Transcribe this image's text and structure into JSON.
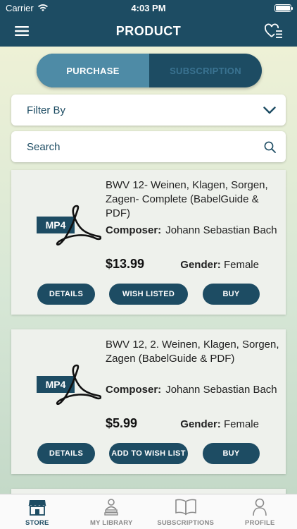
{
  "status_bar": {
    "carrier": "Carrier",
    "time": "4:03 PM"
  },
  "navbar": {
    "title": "PRODUCT",
    "menu_icon": "hamburger-icon",
    "wishlist_icon": "heart-list-icon"
  },
  "segment": {
    "purchase": "PURCHASE",
    "subscription": "SUBSCRIPTION",
    "active": "purchase"
  },
  "filter": {
    "label": "Filter By"
  },
  "search": {
    "placeholder": "Search"
  },
  "products": [
    {
      "format": "MP4",
      "title": "BWV 12- Weinen, Klagen, Sorgen, Zagen- Complete (BabelGuide & PDF)",
      "composer_label": "Composer:",
      "composer": "Johann Sebastian Bach",
      "price": "$13.99",
      "gender_label": "Gender:",
      "gender": "Female",
      "details_label": "DETAILS",
      "wish_label": "WISH LISTED",
      "buy_label": "BUY"
    },
    {
      "format": "MP4",
      "title": "BWV 12, 2. Weinen, Klagen, Sorgen, Zagen (BabelGuide & PDF)",
      "composer_label": "Composer:",
      "composer": "Johann Sebastian Bach",
      "price": "$5.99",
      "gender_label": "Gender:",
      "gender": "Female",
      "details_label": "DETAILS",
      "wish_label": "ADD TO WISH LIST",
      "buy_label": "BUY"
    }
  ],
  "tabbar": {
    "items": [
      {
        "label": "STORE",
        "icon": "store-icon",
        "active": true
      },
      {
        "label": "MY LIBRARY",
        "icon": "library-icon",
        "active": false
      },
      {
        "label": "SUBSCRIPTIONS",
        "icon": "book-icon",
        "active": false
      },
      {
        "label": "PROFILE",
        "icon": "person-icon",
        "active": false
      }
    ]
  },
  "colors": {
    "primary": "#1d4c63",
    "segment_active": "#4e8ba6",
    "inactive_tab": "#8a8a8a"
  }
}
